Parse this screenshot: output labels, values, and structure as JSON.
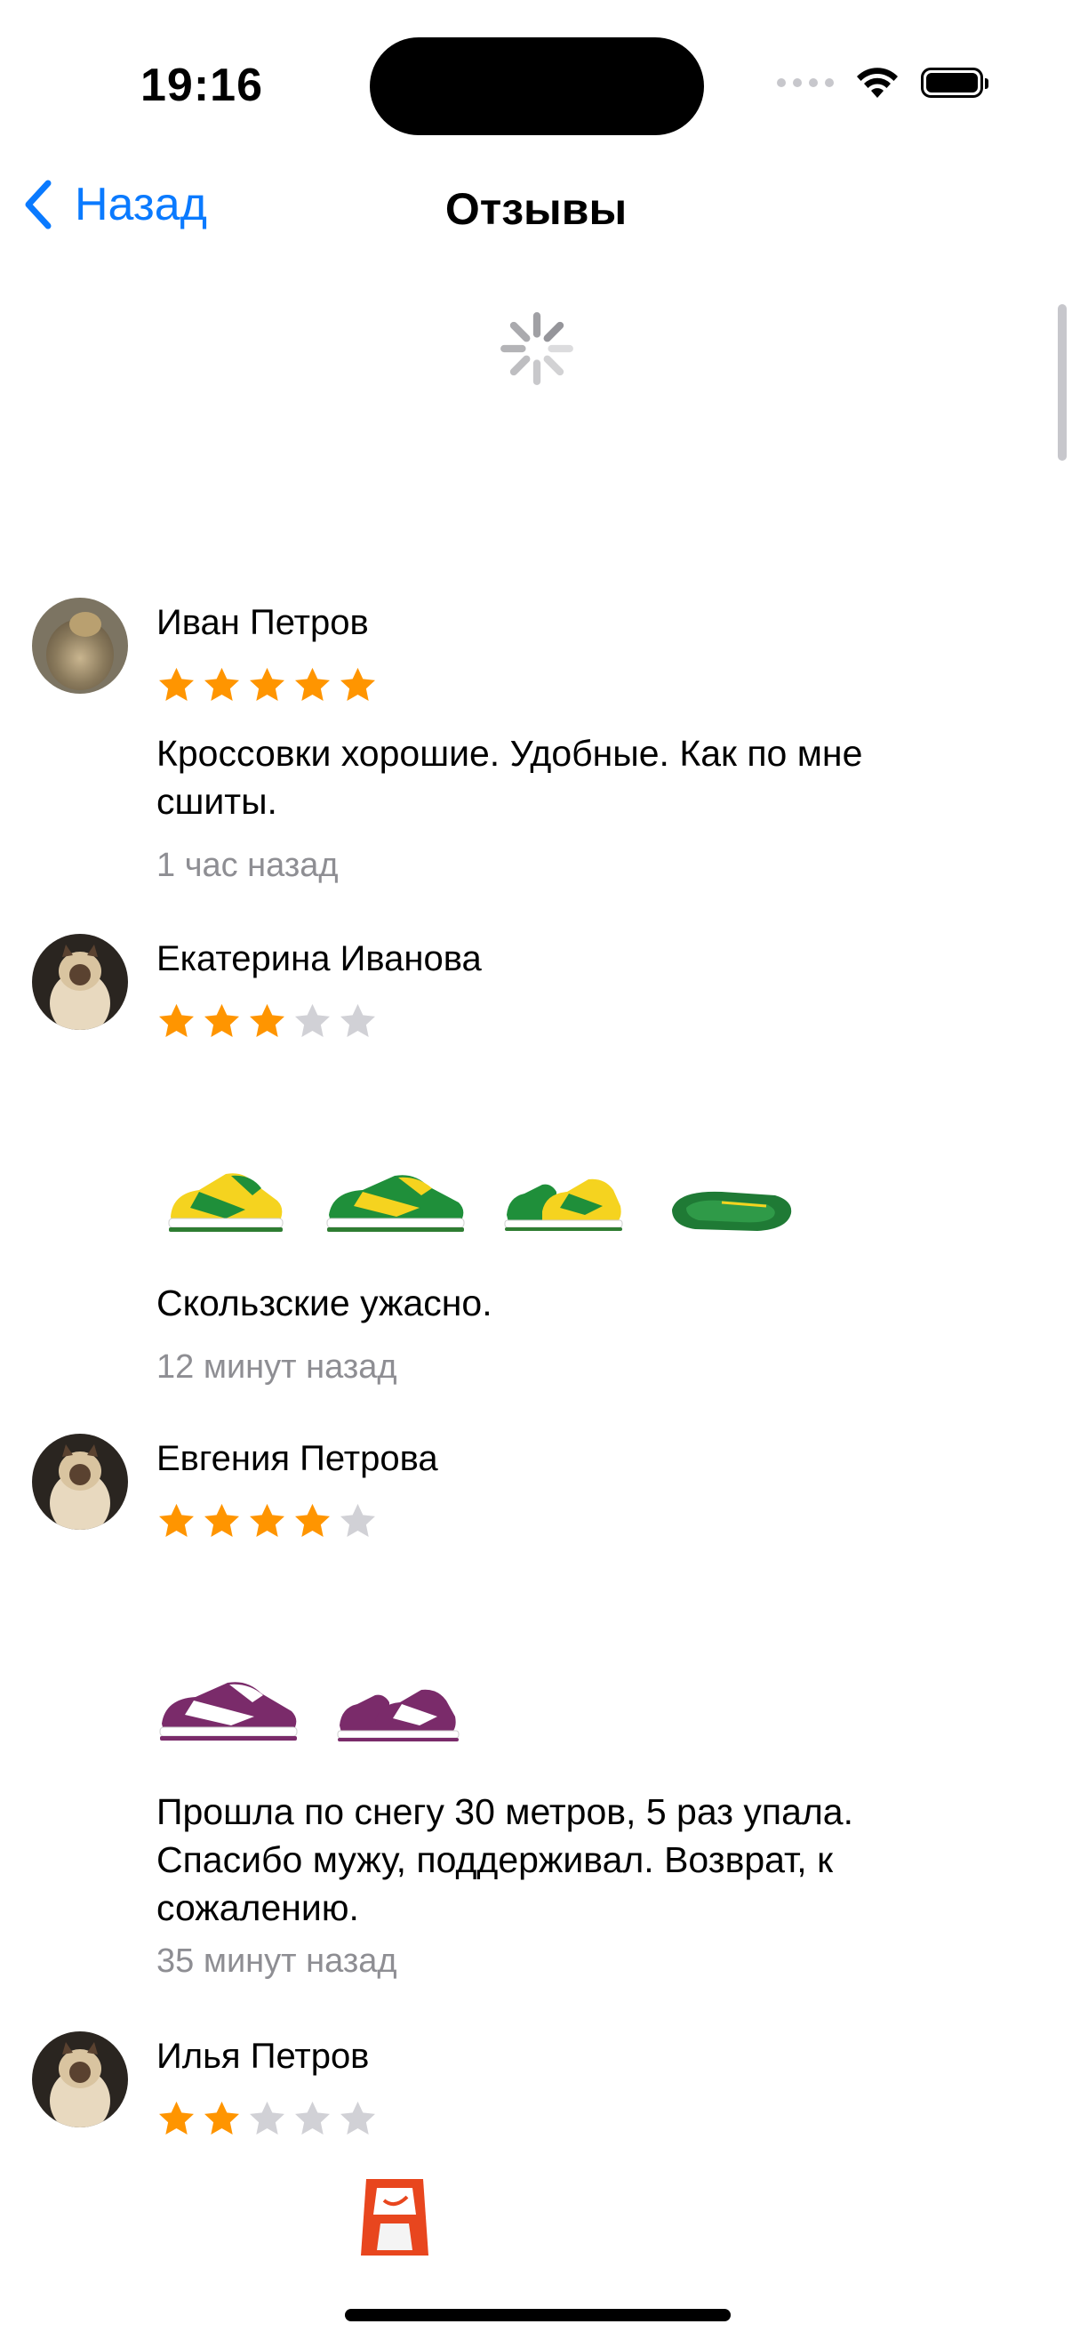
{
  "status_bar": {
    "time": "19:16"
  },
  "nav": {
    "back_label": "Назад",
    "title": "Отзывы"
  },
  "colors": {
    "accent": "#0a7aff",
    "star_active": "#ff9500",
    "star_inactive": "#d1d1d6",
    "secondary_text": "#8e8e93"
  },
  "reviews": [
    {
      "name": "Иван Петров",
      "rating": 5,
      "text": "Кроссовки хорошие. Удобные. Как по мне сшиты.",
      "time": "1 час назад",
      "photos": []
    },
    {
      "name": "Екатерина Иванова",
      "rating": 3,
      "text": "Скользские ужасно.",
      "time": "12 минут назад",
      "photos": [
        "sneaker-green-yellow",
        "sneaker-green-yellow",
        "sneaker-pair-green-yellow",
        "sneaker-sole-green"
      ]
    },
    {
      "name": "Евгения Петрова",
      "rating": 4,
      "text": "Прошла по снегу 30 метров, 5 раз упала. Спасибо мужу, поддерживал. Возврат, к сожалению.",
      "time": "35 минут назад",
      "photos": [
        "sneaker-purple-white",
        "sneaker-pair-purple-white"
      ]
    },
    {
      "name": "Илья Петров",
      "rating": 2,
      "text": "",
      "time": "",
      "photos": [
        "sneaker-orange-white"
      ]
    }
  ]
}
